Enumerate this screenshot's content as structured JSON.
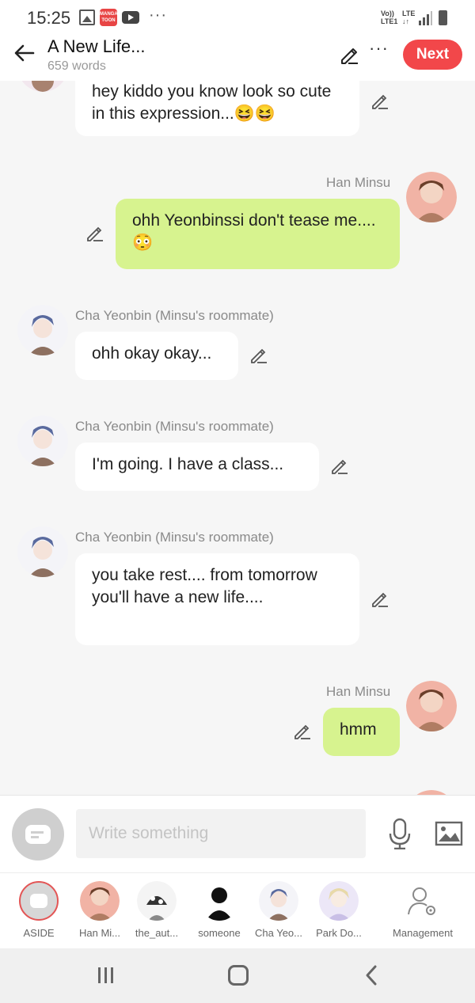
{
  "status_bar": {
    "time": "15:25",
    "volte_line1": "Vo))",
    "volte_line2": "LTE1",
    "lte": "LTE",
    "manga_line1": "MANGA",
    "manga_line2": "TOON"
  },
  "header": {
    "title": "A New Life...",
    "word_count": "659 words",
    "next_label": "Next"
  },
  "messages": [
    {
      "side": "left",
      "sender": "",
      "text": "hey kiddo you know look so cute in this expression...😆😆"
    },
    {
      "side": "right",
      "sender": "Han Minsu",
      "text": "ohh Yeonbinssi don't tease me....😳"
    },
    {
      "side": "left",
      "sender": "Cha Yeonbin (Minsu's roommate)",
      "text": "ohh okay okay..."
    },
    {
      "side": "left",
      "sender": "Cha Yeonbin (Minsu's roommate)",
      "text": "I'm going. I have a class..."
    },
    {
      "side": "left",
      "sender": "Cha Yeonbin (Minsu's roommate)",
      "text": "you take rest.... from tomorrow you'll have a new life...."
    },
    {
      "side": "right",
      "sender": "Han Minsu",
      "text": "hmm"
    }
  ],
  "input": {
    "placeholder": "Write something"
  },
  "characters": [
    {
      "label": "ASIDE"
    },
    {
      "label": "Han Mi..."
    },
    {
      "label": "the_aut..."
    },
    {
      "label": "someone"
    },
    {
      "label": "Cha Yeo..."
    },
    {
      "label": "Park Do..."
    },
    {
      "label": "Management"
    }
  ],
  "colors": {
    "accent": "#f2474a",
    "right_bubble": "#d7f38f",
    "left_bubble": "#ffffff",
    "background": "#f6f6f6"
  }
}
